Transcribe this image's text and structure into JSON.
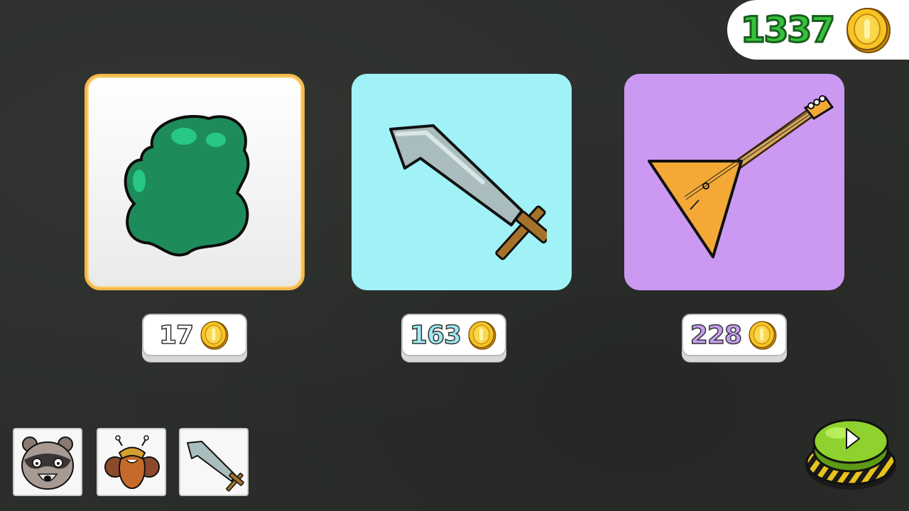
{
  "hud": {
    "coins": "1337",
    "coin_icon": "gold-coin-icon"
  },
  "shop": {
    "items": [
      {
        "name": "slime-blob",
        "price": "17",
        "price_color": "#ffffff",
        "card_bg": "#ffffff",
        "selected": true
      },
      {
        "name": "sword",
        "price": "163",
        "price_color": "#9ee9f2",
        "card_bg": "#a0f2f7",
        "selected": false
      },
      {
        "name": "balalaika",
        "price": "228",
        "price_color": "#c69df0",
        "card_bg": "#cc99f2",
        "selected": false
      }
    ]
  },
  "inventory": {
    "slots": [
      "raccoon-face",
      "bee-character",
      "sword"
    ]
  },
  "colors": {
    "coin_text": "#35c23c",
    "play_button": "#8fd12e",
    "background": "#2b2e2b"
  }
}
